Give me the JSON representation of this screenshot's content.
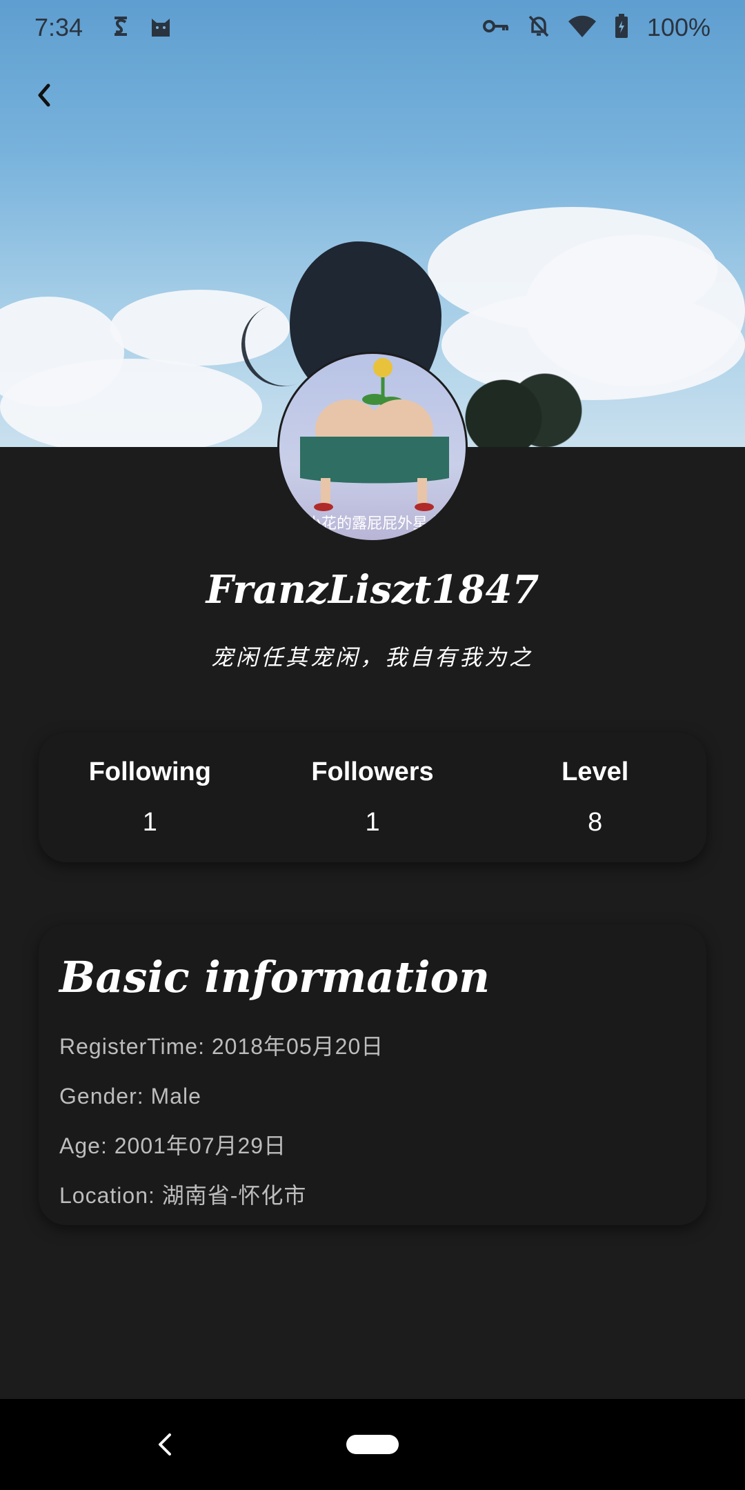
{
  "status_bar": {
    "time": "7:34",
    "battery": "100%",
    "icons": [
      "subscription-icon",
      "cat-icon",
      "vpn-key-icon",
      "notifications-off-icon",
      "wifi-icon",
      "battery-icon"
    ]
  },
  "profile": {
    "username": "FranzLiszt1847",
    "bio": "宠闲任其宠闲，我自有我为之",
    "avatar_caption": "小花的露屁屁外星人"
  },
  "stats": [
    {
      "label": "Following",
      "value": "1"
    },
    {
      "label": "Followers",
      "value": "1"
    },
    {
      "label": "Level",
      "value": "8"
    }
  ],
  "basic_info": {
    "title": "Basic information",
    "rows": [
      "RegisterTime: 2018年05月20日",
      "Gender: Male",
      "Age: 2001年07月29日",
      "Location: 湖南省-怀化市"
    ]
  },
  "colors": {
    "background": "#1c1c1d",
    "card": "#1a1a1b",
    "text": "#ffffff",
    "muted_text": "#bdbdbd"
  }
}
